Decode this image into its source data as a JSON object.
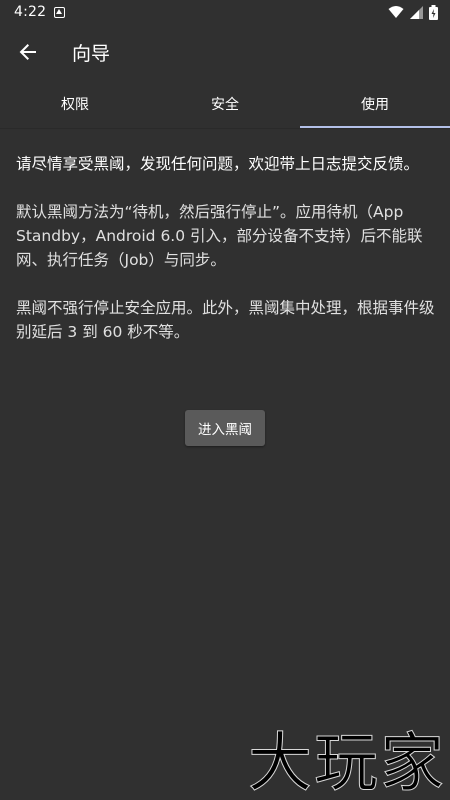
{
  "status_bar": {
    "time": "4:22",
    "icons": [
      "notification-icon",
      "wifi-icon",
      "signal-icon",
      "battery-icon"
    ]
  },
  "app_bar": {
    "back_icon": "arrow-back-icon",
    "title": "向导"
  },
  "tabs": [
    {
      "label": "权限",
      "active": false
    },
    {
      "label": "安全",
      "active": false
    },
    {
      "label": "使用",
      "active": true
    }
  ],
  "content": {
    "intro": "请尽情享受黑阈，发现任何问题，欢迎带上日志提交反馈。",
    "paragraph1": "默认黑阈方法为“待机，然后强行停止”。应用待机（App Standby，Android 6.0 引入，部分设备不支持）后不能联网、执行任务（Job）与同步。",
    "paragraph2": "黑阈不强行停止安全应用。此外，黑阈集中处理，根据事件级别延后 3 到 60 秒不等。",
    "enter_button": "进入黑阈"
  },
  "watermark": "大玩家",
  "colors": {
    "background": "#303030",
    "tab_indicator": "#b3c0e8",
    "button_bg": "#5a5a5a"
  }
}
